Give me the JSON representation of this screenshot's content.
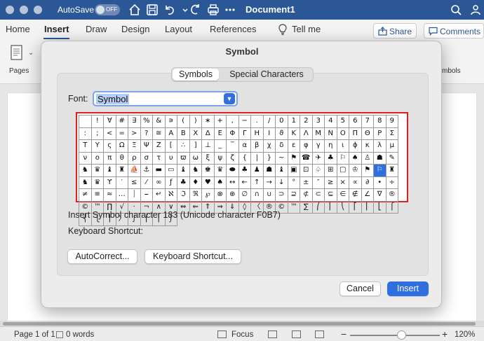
{
  "titlebar": {
    "autosave_label": "AutoSave",
    "autosave_state": "OFF",
    "document_title": "Document1"
  },
  "ribbon": {
    "tabs": [
      "Home",
      "Insert",
      "Draw",
      "Design",
      "Layout",
      "References"
    ],
    "tell_me": "Tell me",
    "share_label": "Share",
    "comments_label": "Comments",
    "pages_label": "Pages",
    "symbols_label": "mbols"
  },
  "dialog": {
    "title": "Symbol",
    "tab_symbols": "Symbols",
    "tab_special": "Special Characters",
    "font_label": "Font:",
    "font_value": "Symbol",
    "selected_index": 128,
    "symbols": [
      " ",
      "!",
      "∀",
      "#",
      "∃",
      "%",
      "&",
      "∍",
      "(",
      ")",
      "∗",
      "+",
      ",",
      "−",
      ".",
      "/",
      "0",
      "1",
      "2",
      "3",
      "4",
      "5",
      "6",
      "7",
      "8",
      "9",
      ":",
      ";",
      "<",
      "=",
      ">",
      "?",
      "≅",
      "Α",
      "Β",
      "Χ",
      "Δ",
      "Ε",
      "Φ",
      "Γ",
      "Η",
      "Ι",
      "ϑ",
      "Κ",
      "Λ",
      "Μ",
      "Ν",
      "Ο",
      "Π",
      "Θ",
      "Ρ",
      "Σ",
      "Τ",
      "Υ",
      "ς",
      "Ω",
      "Ξ",
      "Ψ",
      "Ζ",
      "[",
      "∴",
      "]",
      "⊥",
      "_",
      "‾",
      "α",
      "β",
      "χ",
      "δ",
      "ε",
      "φ",
      "γ",
      "η",
      "ι",
      "ϕ",
      "κ",
      "λ",
      "μ",
      "ν",
      "ο",
      "π",
      "θ",
      "ρ",
      "σ",
      "τ",
      "υ",
      "ϖ",
      "ω",
      "ξ",
      "ψ",
      "ζ",
      "{",
      "|",
      "}",
      "~",
      "⚑",
      "☎",
      "✈",
      "♣",
      "⚐",
      "♠",
      "♙",
      "☗",
      "✎",
      "♞",
      "♛",
      "♝",
      "♜",
      "⛵",
      "⚓",
      "▬",
      "▭",
      "♝",
      "♞",
      "♚",
      "♛",
      "⬬",
      "♣",
      "♟",
      "☗",
      "♝",
      "▣",
      "⊡",
      "♤",
      "⊞",
      "▢",
      "♔",
      "⚑",
      "⚐",
      "♜",
      "♞",
      "♛",
      "ϒ",
      "′",
      "≤",
      "⁄",
      "∞",
      "ƒ",
      "♣",
      "♦",
      "♥",
      "♠",
      "↔",
      "←",
      "↑",
      "→",
      "↓",
      "°",
      "±",
      "″",
      "≥",
      "×",
      "∝",
      "∂",
      "•",
      "÷",
      "≠",
      "≡",
      "≈",
      "…",
      "⏐",
      "⎯",
      "↵",
      "ℵ",
      "ℑ",
      "ℜ",
      "℘",
      "⊗",
      "⊕",
      "∅",
      "∩",
      "∪",
      "⊃",
      "⊇",
      "⊄",
      "⊂",
      "⊆",
      "∈",
      "∉",
      "∠",
      "∇",
      "®",
      "©",
      "™",
      "∏",
      "√",
      "⋅",
      "¬",
      "∧",
      "∨",
      "⇔",
      "⇐",
      "⇑",
      "⇒",
      "⇓",
      "◊",
      "〈",
      "®",
      "©",
      "™",
      "∑",
      "⎛",
      "⎜",
      "⎝",
      "⎡",
      "⎢",
      "⎣",
      "⎧",
      "⎨",
      "⎩",
      "⎪",
      "〉",
      "∫",
      "⌠",
      "⎮",
      "⌡"
    ],
    "char_info": "Insert Symbol character 183  (Unicode character F0B7)",
    "keyboard_shortcut_label": "Keyboard Shortcut:",
    "autocorrect_button": "AutoCorrect...",
    "keyboard_shortcut_button": "Keyboard Shortcut...",
    "cancel_button": "Cancel",
    "insert_button": "Insert"
  },
  "statusbar": {
    "page": "Page 1 of 1",
    "words": "0 words",
    "focus": "Focus",
    "zoom_minus": "−",
    "zoom_plus": "+",
    "zoom": "120%"
  },
  "colors": {
    "titlebar": "#2b5797",
    "accent": "#2f6fe0",
    "grid_highlight": "#e01f1f"
  }
}
